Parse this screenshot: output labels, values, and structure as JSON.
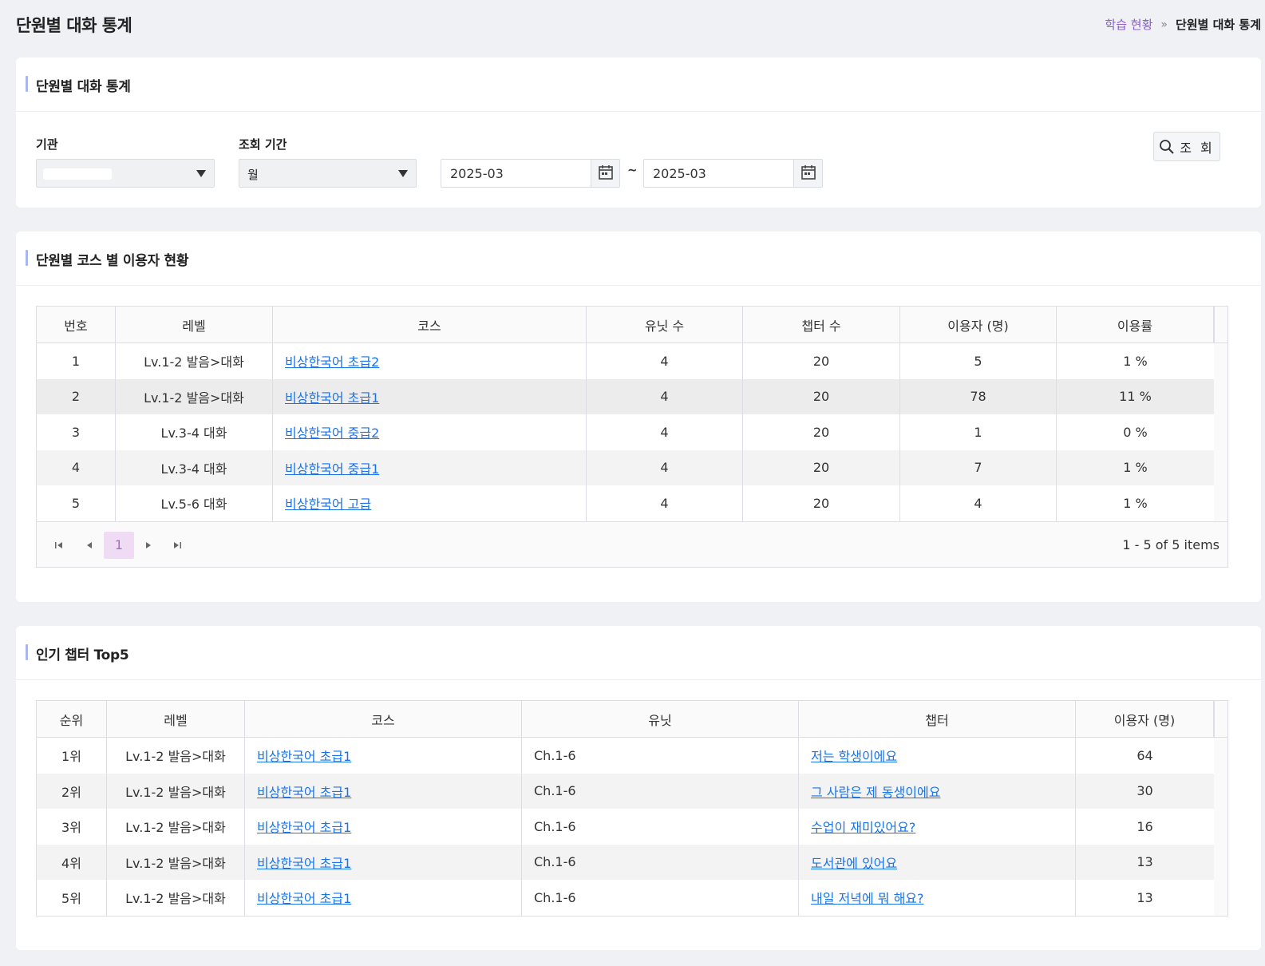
{
  "page": {
    "title": "단원별 대화 통계",
    "breadcrumb": {
      "parent": "학습 현황",
      "separator": "»",
      "current": "단원별 대화 통계"
    }
  },
  "search_panel": {
    "title": "단원별 대화 통계",
    "org_label": "기관",
    "org_value": "",
    "period_label": "조회 기간",
    "period_value": "월",
    "date_from": "2025-03",
    "date_to": "2025-03",
    "range_sep": "~",
    "search_button": "조 회"
  },
  "course_panel": {
    "title": "단원별 코스 별 이용자 현황",
    "columns": [
      "번호",
      "레벨",
      "코스",
      "유닛 수",
      "챕터 수",
      "이용자 (명)",
      "이용률"
    ],
    "rows": [
      {
        "no": "1",
        "level": "Lv.1-2 발음>대화",
        "course": "비상한국어 초급2",
        "units": "4",
        "chapters": "20",
        "users": "5",
        "rate": "1 %"
      },
      {
        "no": "2",
        "level": "Lv.1-2 발음>대화",
        "course": "비상한국어 초급1",
        "units": "4",
        "chapters": "20",
        "users": "78",
        "rate": "11 %"
      },
      {
        "no": "3",
        "level": "Lv.3-4 대화",
        "course": "비상한국어 중급2",
        "units": "4",
        "chapters": "20",
        "users": "1",
        "rate": "0 %"
      },
      {
        "no": "4",
        "level": "Lv.3-4 대화",
        "course": "비상한국어 중급1",
        "units": "4",
        "chapters": "20",
        "users": "7",
        "rate": "1 %"
      },
      {
        "no": "5",
        "level": "Lv.5-6 대화",
        "course": "비상한국어 고급",
        "units": "4",
        "chapters": "20",
        "users": "4",
        "rate": "1 %"
      }
    ],
    "pager": {
      "current_page": "1",
      "info": "1 - 5 of 5 items"
    }
  },
  "top5_panel": {
    "title": "인기 챕터 Top5",
    "columns": [
      "순위",
      "레벨",
      "코스",
      "유닛",
      "챕터",
      "이용자 (명)"
    ],
    "rows": [
      {
        "rank": "1위",
        "level": "Lv.1-2 발음>대화",
        "course": "비상한국어 초급1",
        "unit": "Ch.1-6",
        "chapter": "저는 학생이에요",
        "users": "64"
      },
      {
        "rank": "2위",
        "level": "Lv.1-2 발음>대화",
        "course": "비상한국어 초급1",
        "unit": "Ch.1-6",
        "chapter": "그 사람은 제 동생이에요",
        "users": "30"
      },
      {
        "rank": "3위",
        "level": "Lv.1-2 발음>대화",
        "course": "비상한국어 초급1",
        "unit": "Ch.1-6",
        "chapter": "수업이 재미있어요?",
        "users": "16"
      },
      {
        "rank": "4위",
        "level": "Lv.1-2 발음>대화",
        "course": "비상한국어 초급1",
        "unit": "Ch.1-6",
        "chapter": "도서관에 있어요",
        "users": "13"
      },
      {
        "rank": "5위",
        "level": "Lv.1-2 발음>대화",
        "course": "비상한국어 초급1",
        "unit": "Ch.1-6",
        "chapter": "내일 저녁에 뭐 해요?",
        "users": "13"
      }
    ]
  },
  "colors": {
    "accent_bar": "#a9b6ee",
    "link": "#1a73e8",
    "breadcrumb_link": "#8a5cd1",
    "pager_active": "#efdcf4"
  },
  "icons": {
    "calendar": "calendar-icon",
    "search": "search-icon",
    "caret": "chevron-down-icon"
  }
}
